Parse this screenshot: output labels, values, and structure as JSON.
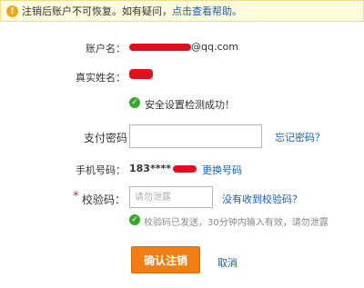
{
  "notice": {
    "icon": "warning-icon",
    "text": "注销后账户不可恢复。如有疑问，",
    "link_text": "点击查看帮助。"
  },
  "account": {
    "label": "账户名：",
    "value_suffix": "@qq.com"
  },
  "real_name": {
    "label": "真实姓名："
  },
  "security_check": {
    "icon": "check-circle-icon",
    "text": "安全设置检测成功！"
  },
  "payment_password": {
    "label": "支付密码",
    "placeholder": "",
    "forgot_link": "忘记密码？"
  },
  "phone": {
    "label": "手机号码：",
    "value_prefix": "183****",
    "change_link": "更换号码"
  },
  "verify_code": {
    "required_mark": "*",
    "label": "校验码：",
    "placeholder": "请勿泄露",
    "not_received_link": "没有收到校验码？",
    "hint_icon": "check-circle-icon",
    "hint_text": "校验码已发送，30分钟内输入有效，请勿泄露"
  },
  "actions": {
    "confirm_label": "确认注销",
    "cancel_label": "取消"
  },
  "colors": {
    "link": "#1a5fb4",
    "confirm_button": "#f07e14",
    "success": "#3aa82e",
    "redaction": "#e0101e",
    "notice_bg": "#fffbdd"
  }
}
